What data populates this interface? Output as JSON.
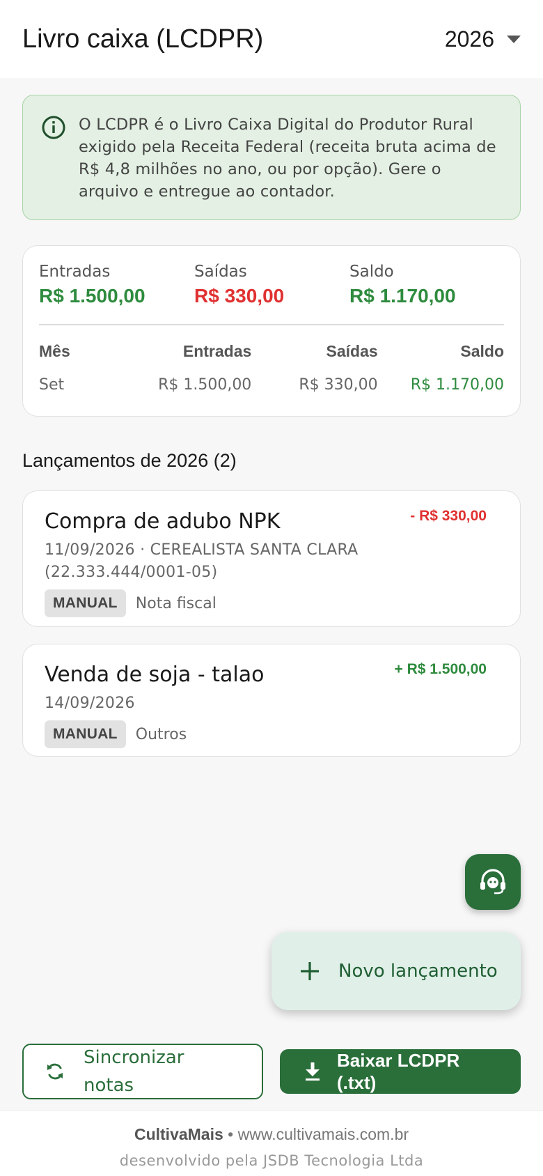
{
  "appbar": {
    "title": "Livro caixa (LCDPR)",
    "year": "2026"
  },
  "info": {
    "text": "O LCDPR é o Livro Caixa Digital do Produtor Rural exigido pela Receita Federal (receita bruta acima de R$ 4,8 milhões no ano, ou por opção). Gere o arquivo e entregue ao contador."
  },
  "summary": {
    "totals": [
      {
        "label": "Entradas",
        "value": "R$ 1.500,00"
      },
      {
        "label": "Saídas",
        "value": "R$ 330,00"
      },
      {
        "label": "Saldo",
        "value": "R$ 1.170,00"
      }
    ],
    "columns": [
      "Mês",
      "Entradas",
      "Saídas",
      "Saldo"
    ],
    "rows": [
      {
        "month": "Set",
        "entradas": "R$ 1.500,00",
        "saidas": "R$ 330,00",
        "saldo": "R$ 1.170,00"
      }
    ]
  },
  "entries_section": {
    "title": "Lançamentos de 2026 (2)"
  },
  "entries": [
    {
      "title": "Compra de adubo NPK",
      "amount": "- R$ 330,00",
      "meta": "11/09/2026 · CEREALISTA SANTA CLARA (22.333.444/0001-05)",
      "badge": "MANUAL",
      "type": "Nota fiscal"
    },
    {
      "title": "Venda de soja - talao",
      "amount": "+ R$ 1.500,00",
      "meta": "14/09/2026",
      "badge": "MANUAL",
      "type": "Outros"
    }
  ],
  "fab": {
    "new_label": "Novo lançamento"
  },
  "actions": {
    "sync_label": "Sincronizar notas",
    "download_label": "Baixar LCDPR (.txt)"
  },
  "footer": {
    "brand": "CultivaMais",
    "separator": " • ",
    "url": "www.cultivamais.com.br",
    "credit": "desenvolvido pela JSDB Tecnologia Ltda"
  },
  "colors": {
    "primary": "#2a6e3a",
    "positive": "#2e8b3e",
    "negative": "#e03131",
    "info_bg": "#e3f0e3"
  },
  "icons": {
    "info": "info-icon",
    "support": "headset-icon",
    "add": "plus-icon",
    "sync": "sync-icon",
    "download": "download-icon",
    "dropdown": "caret-down-icon"
  }
}
